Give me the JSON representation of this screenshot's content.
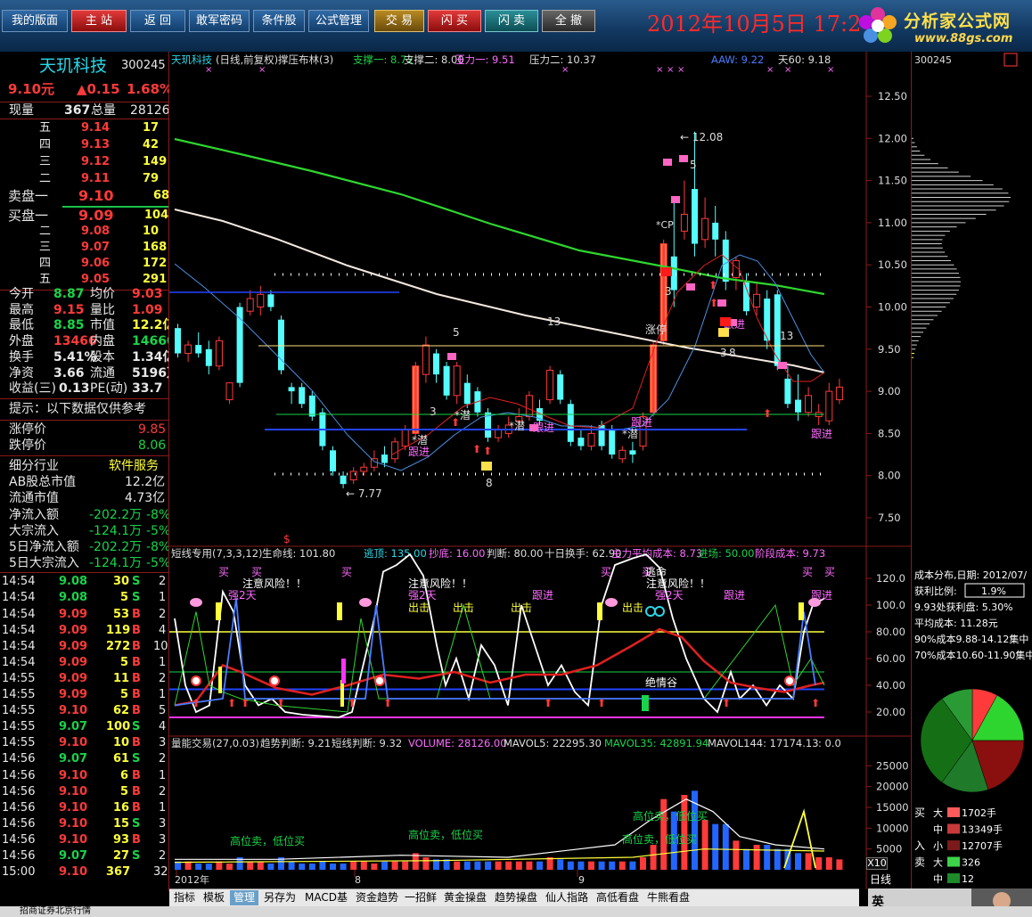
{
  "toolbar": {
    "buttons": [
      "我的版面",
      "主 站",
      "返 回",
      "敢军密码",
      "条件股",
      "公式管理",
      "交 易",
      "闪 买",
      "闪 卖",
      "全 撤"
    ],
    "datetime": "2012年10月5日  17:2"
  },
  "logo": {
    "brand": "分析家公式网",
    "url": "www.88gs.com"
  },
  "stock": {
    "name": "天玑科技",
    "code": "300245",
    "price": "9.10元",
    "change": "▲0.15",
    "pct": "1.68%"
  },
  "quote": {
    "vol_labels": [
      "现量",
      "总量"
    ],
    "vol_values": [
      "367",
      "28126"
    ],
    "sells": [
      {
        "label": "五",
        "price": "9.14",
        "vol": "17"
      },
      {
        "label": "四",
        "price": "9.13",
        "vol": "42"
      },
      {
        "label": "三",
        "price": "9.12",
        "vol": "149"
      },
      {
        "label": "二",
        "price": "9.11",
        "vol": "79"
      },
      {
        "label": "卖盘一",
        "price": "9.10",
        "vol": "68"
      }
    ],
    "buys": [
      {
        "label": "买盘一",
        "price": "9.09",
        "vol": "104"
      },
      {
        "label": "二",
        "price": "9.08",
        "vol": "10"
      },
      {
        "label": "三",
        "price": "9.07",
        "vol": "168"
      },
      {
        "label": "四",
        "price": "9.06",
        "vol": "172"
      },
      {
        "label": "五",
        "price": "9.05",
        "vol": "291"
      }
    ],
    "stats": [
      [
        "今开",
        "8.87",
        "均价",
        "9.03"
      ],
      [
        "最高",
        "9.15",
        "量比",
        "1.09"
      ],
      [
        "最低",
        "8.85",
        "市值",
        "12.2亿"
      ],
      [
        "外盘",
        "13466",
        "内盘",
        "14660"
      ],
      [
        "换手",
        "5.41%",
        "股本",
        "1.34亿"
      ],
      [
        "净资",
        "3.66",
        "流通",
        "5196万"
      ],
      [
        "收益(三)",
        "0.13",
        "PE(动)",
        "33.7"
      ]
    ],
    "tip": "提示：以下数据仅供参考",
    "limits": [
      [
        "涨停价",
        "9.85"
      ],
      [
        "跌停价",
        "8.06"
      ]
    ],
    "info": [
      [
        "细分行业",
        "软件服务"
      ],
      [
        "AB股总市值",
        "12.2亿"
      ],
      [
        "流通市值",
        "4.73亿"
      ],
      [
        "净流入额",
        "-202.2万",
        "-8%"
      ],
      [
        "大宗流入",
        "-124.1万",
        "-5%"
      ],
      [
        "5日净流入额",
        "-202.2万",
        "-8%"
      ],
      [
        "5日大宗流入",
        "-124.1万",
        "-5%"
      ]
    ],
    "ticks": [
      [
        "14:54",
        "9.08",
        "30",
        "S",
        "2"
      ],
      [
        "14:54",
        "9.08",
        "5",
        "S",
        "1"
      ],
      [
        "14:54",
        "9.09",
        "53",
        "B",
        "2"
      ],
      [
        "14:54",
        "9.09",
        "119",
        "B",
        "4"
      ],
      [
        "14:54",
        "9.09",
        "272",
        "B",
        "10"
      ],
      [
        "14:54",
        "9.09",
        "5",
        "B",
        "1"
      ],
      [
        "14:55",
        "9.09",
        "11",
        "B",
        "2"
      ],
      [
        "14:55",
        "9.09",
        "5",
        "B",
        "1"
      ],
      [
        "14:55",
        "9.10",
        "62",
        "B",
        "5"
      ],
      [
        "14:55",
        "9.07",
        "100",
        "S",
        "4"
      ],
      [
        "14:55",
        "9.10",
        "10",
        "B",
        "3"
      ],
      [
        "14:56",
        "9.07",
        "61",
        "S",
        "2"
      ],
      [
        "14:56",
        "9.10",
        "6",
        "B",
        "1"
      ],
      [
        "14:56",
        "9.10",
        "5",
        "B",
        "2"
      ],
      [
        "14:56",
        "9.10",
        "16",
        "B",
        "1"
      ],
      [
        "14:56",
        "9.10",
        "15",
        "S",
        "3"
      ],
      [
        "14:56",
        "9.10",
        "93",
        "B",
        "3"
      ],
      [
        "14:56",
        "9.07",
        "27",
        "S",
        "2"
      ],
      [
        "15:00",
        "9.10",
        "367",
        "",
        "32"
      ]
    ]
  },
  "main_chart": {
    "header": [
      "天玑科技",
      "(日线,前复权)",
      "撑压布林(3)",
      "支撑一: 8.72",
      "支撑二: 8.00",
      "压力一: 9.51",
      "压力二: 10.37"
    ],
    "header_right": [
      "AAW: 9.22",
      "天60: 9.18"
    ],
    "y_ticks": [
      "12.50",
      "12.00",
      "11.50",
      "11.00",
      "10.50",
      "10.00",
      "9.50",
      "9.00",
      "8.50",
      "8.00",
      "7.50"
    ],
    "annotations": {
      "high": "12.08",
      "low": "7.77",
      "cp": "*CP",
      "limit_up": "涨停",
      "counts": [
        "5",
        "13",
        "3",
        "5",
        "3",
        "13",
        "3",
        "8",
        "8"
      ],
      "signals": [
        "跟进",
        "跟进",
        "跟进",
        "跟进",
        "跟进",
        "跟进",
        "*潜",
        "*潜",
        "*潜",
        "*潜"
      ]
    }
  },
  "mid_chart": {
    "header": [
      "短线专用(7,3,3,12)",
      "生命线: 101.80",
      "逃顶: 135.00",
      "抄底: 16.00",
      "判断: 80.00",
      "十日换手: 62.90",
      "主力平均成本: 8.73",
      "进场: 50.00",
      "阶段成本: 9.73"
    ],
    "y_ticks": [
      "120.0",
      "100.0",
      "80.00",
      "60.00",
      "40.00",
      "20.00"
    ],
    "labels": [
      "买",
      "买",
      "买",
      "买",
      "买",
      "买",
      "买",
      "注意风险！！",
      "注意风险！！",
      "注意风险！！",
      "强2天",
      "强2天",
      "出击",
      "出击",
      "出击",
      "出击",
      "跟进",
      "跟进",
      "跟进",
      "逃命",
      "绝情谷",
      "强2天"
    ]
  },
  "vol_chart": {
    "header": [
      "量能交易(27,0.03)",
      "趋势判断: 9.21",
      "短线判断: 9.32",
      "VOLUME: 28126.00",
      "MAVOL5: 22295.30",
      "MAVOL35: 42891.94",
      "MAVOL144: 17174.13",
      ": 0.0"
    ],
    "y_ticks": [
      "25000",
      "20000",
      "15000",
      "10000",
      "5000"
    ],
    "x_labels": [
      "2012年",
      "8",
      "9"
    ],
    "labels": [
      "高位卖，低位买",
      "高位卖，低位买",
      "高位卖，低位买",
      "高位卖，低位买"
    ]
  },
  "right_panel": {
    "code": "300245",
    "y_ticks": [
      "12.50",
      "12.00",
      "11.50",
      "11.00",
      "10.50",
      "10.00",
      "9.50",
      "9.00",
      "8.50",
      "8.00",
      "7.50"
    ],
    "cost": {
      "title": "成本分布,日期: 2012/07/",
      "ratio_label": "获利比例:",
      "ratio": "1.9%",
      "lines": [
        "9.93处获利盘: 5.30%",
        "平均成本: 11.28元",
        "90%成本9.88-14.12集中",
        "70%成本10.60-11.90集中"
      ]
    },
    "flow": [
      {
        "side": "买",
        "size": "大",
        "value": "1702手"
      },
      {
        "side": "",
        "size": "中",
        "value": "13349手"
      },
      {
        "side": "入",
        "size": "小",
        "value": "12707手"
      },
      {
        "side": "卖",
        "size": "大",
        "value": "326"
      },
      {
        "side": "",
        "size": "中",
        "value": "12"
      }
    ],
    "x10": "X10",
    "period": "日线"
  },
  "tabs": [
    "指标",
    "模板",
    "管理",
    "另存为",
    "MACD基本",
    "资金趋势",
    "一招鲜",
    "黄金操盘",
    "趋势操盘",
    "仙人指路",
    "高低看盘",
    "牛熊看盘"
  ],
  "statusbar": "招商证券北京行情",
  "tray": {
    "ime": "英"
  }
}
